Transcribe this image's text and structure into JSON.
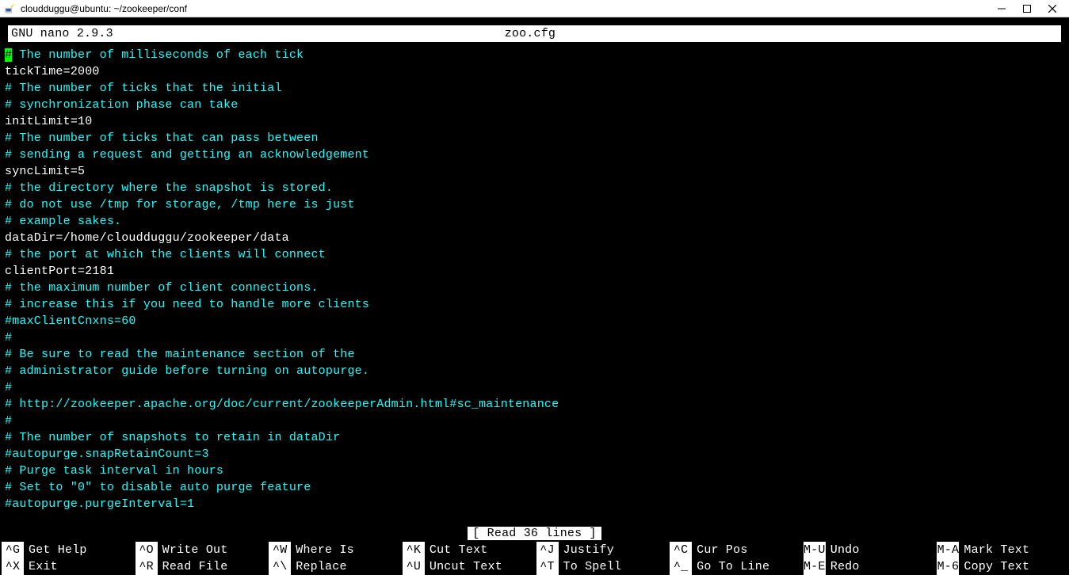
{
  "window": {
    "title": "cloudduggu@ubuntu: ~/zookeeper/conf"
  },
  "nano": {
    "app": "  GNU nano 2.9.3",
    "file": "zoo.cfg",
    "status": "[ Read 36 lines ]"
  },
  "lines": [
    {
      "type": "comment_cursor",
      "hash": "#",
      "rest": " The number of milliseconds of each tick"
    },
    {
      "type": "setting",
      "text": "tickTime=2000"
    },
    {
      "type": "comment",
      "text": "# The number of ticks that the initial"
    },
    {
      "type": "comment",
      "text": "# synchronization phase can take"
    },
    {
      "type": "setting",
      "text": "initLimit=10"
    },
    {
      "type": "comment",
      "text": "# The number of ticks that can pass between"
    },
    {
      "type": "comment",
      "text": "# sending a request and getting an acknowledgement"
    },
    {
      "type": "setting",
      "text": "syncLimit=5"
    },
    {
      "type": "comment",
      "text": "# the directory where the snapshot is stored."
    },
    {
      "type": "comment",
      "text": "# do not use /tmp for storage, /tmp here is just"
    },
    {
      "type": "comment",
      "text": "# example sakes."
    },
    {
      "type": "setting",
      "text": "dataDir=/home/cloudduggu/zookeeper/data"
    },
    {
      "type": "comment",
      "text": "# the port at which the clients will connect"
    },
    {
      "type": "setting",
      "text": "clientPort=2181"
    },
    {
      "type": "comment",
      "text": "# the maximum number of client connections."
    },
    {
      "type": "comment",
      "text": "# increase this if you need to handle more clients"
    },
    {
      "type": "comment",
      "text": "#maxClientCnxns=60"
    },
    {
      "type": "comment",
      "text": "#"
    },
    {
      "type": "comment",
      "text": "# Be sure to read the maintenance section of the"
    },
    {
      "type": "comment",
      "text": "# administrator guide before turning on autopurge."
    },
    {
      "type": "comment",
      "text": "#"
    },
    {
      "type": "comment",
      "text": "# http://zookeeper.apache.org/doc/current/zookeeperAdmin.html#sc_maintenance"
    },
    {
      "type": "comment",
      "text": "#"
    },
    {
      "type": "comment",
      "text": "# The number of snapshots to retain in dataDir"
    },
    {
      "type": "comment",
      "text": "#autopurge.snapRetainCount=3"
    },
    {
      "type": "comment",
      "text": "# Purge task interval in hours"
    },
    {
      "type": "comment",
      "text": "# Set to \"0\" to disable auto purge feature"
    },
    {
      "type": "comment",
      "text": "#autopurge.purgeInterval=1"
    }
  ],
  "shortcuts": {
    "cols": [
      {
        "a": {
          "key": "^G",
          "label": "Get Help"
        },
        "b": {
          "key": "^X",
          "label": "Exit"
        }
      },
      {
        "a": {
          "key": "^O",
          "label": "Write Out"
        },
        "b": {
          "key": "^R",
          "label": "Read File"
        }
      },
      {
        "a": {
          "key": "^W",
          "label": "Where Is"
        },
        "b": {
          "key": "^\\",
          "label": "Replace"
        }
      },
      {
        "a": {
          "key": "^K",
          "label": "Cut Text"
        },
        "b": {
          "key": "^U",
          "label": "Uncut Text"
        }
      },
      {
        "a": {
          "key": "^J",
          "label": "Justify"
        },
        "b": {
          "key": "^T",
          "label": "To Spell"
        }
      },
      {
        "a": {
          "key": "^C",
          "label": "Cur Pos"
        },
        "b": {
          "key": "^_",
          "label": "Go To Line"
        }
      },
      {
        "a": {
          "key": "M-U",
          "label": "Undo"
        },
        "b": {
          "key": "M-E",
          "label": "Redo"
        }
      },
      {
        "a": {
          "key": "M-A",
          "label": "Mark Text"
        },
        "b": {
          "key": "M-6",
          "label": "Copy Text"
        }
      }
    ]
  }
}
